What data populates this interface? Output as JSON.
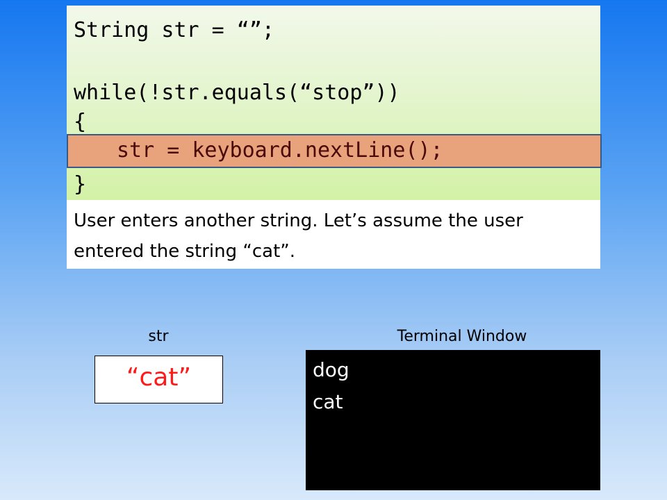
{
  "code": {
    "line1": "String str = “”;",
    "line2": "while(!str.equals(“stop”))",
    "line3": "{",
    "line4_highlighted": "str = keyboard.nextLine();",
    "line5": "}"
  },
  "description": "User enters another string. Let’s assume the user entered the string “cat”.",
  "variable": {
    "name": "str",
    "value": "“cat”"
  },
  "terminal": {
    "title": "Terminal Window",
    "lines": [
      "dog",
      "cat"
    ]
  },
  "colors": {
    "highlight_row": "#e9a37c",
    "highlight_border": "#3a5a86",
    "variable_value": "#ff1a1a",
    "terminal_bg": "#000000",
    "code_panel": "#e4f5cf"
  }
}
